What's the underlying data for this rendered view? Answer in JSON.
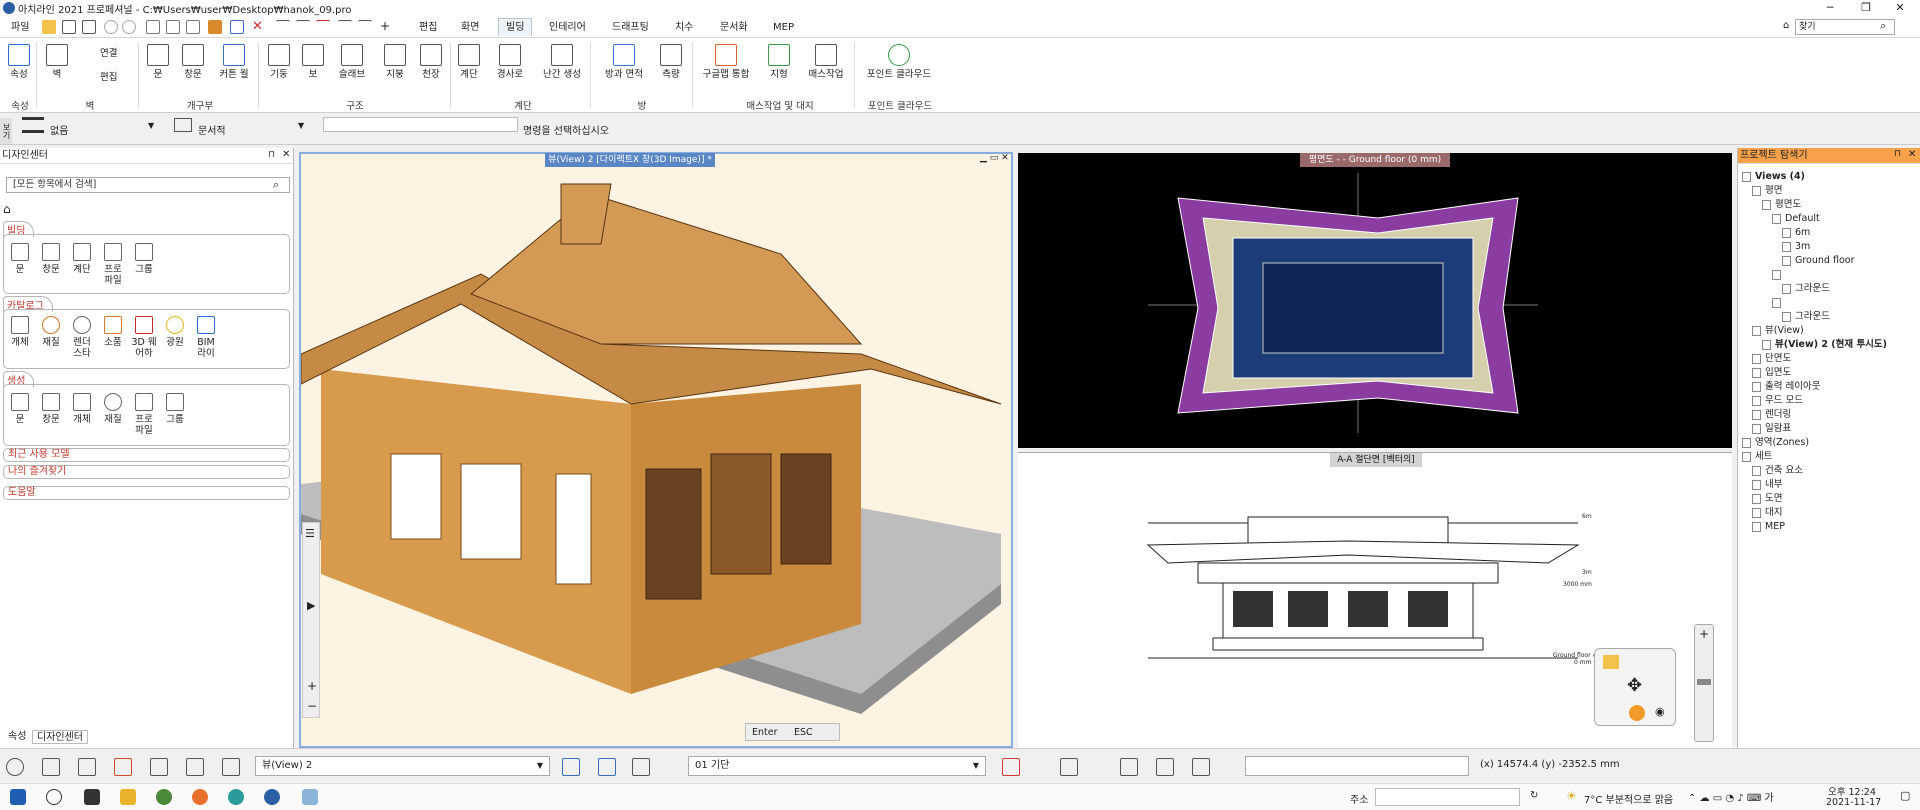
{
  "window": {
    "title": "아치라인 2021  프로페셔널 - C:₩Users₩user₩Desktop₩hanok_09.pro",
    "controls": [
      "─",
      "❐",
      "✕"
    ]
  },
  "menu_tabs": [
    "파일",
    "편집",
    "화면",
    "빌딩",
    "인테리어",
    "드래프팅",
    "치수",
    "문서화",
    "MEP"
  ],
  "search_placeholder": "찾기",
  "ribbon": {
    "buttons": [
      {
        "label": "속성"
      },
      {
        "label": "벽"
      },
      {
        "label": "연결"
      },
      {
        "label": "편집"
      },
      {
        "label": "문"
      },
      {
        "label": "창문"
      },
      {
        "label": "커튼 월"
      },
      {
        "label": "기둥"
      },
      {
        "label": "보"
      },
      {
        "label": "슬래브"
      },
      {
        "label": "지붕"
      },
      {
        "label": "천장"
      },
      {
        "label": "계단"
      },
      {
        "label": "경사로"
      },
      {
        "label": "난간 생성"
      },
      {
        "label": "방과 면적"
      },
      {
        "label": "측량"
      },
      {
        "label": "구글맵 통합"
      },
      {
        "label": "지형"
      },
      {
        "label": "매스작업"
      },
      {
        "label": "포인트 클라우드"
      }
    ],
    "groups": [
      "속성",
      "벽",
      "개구부",
      "구조",
      "계단",
      "방",
      "매스작업 및 대지",
      "포인트 클라우드"
    ]
  },
  "infobar": {
    "side_tab": "보기",
    "layer": "없음",
    "doc": "문서적",
    "prompt": "명령을 선택하십시오"
  },
  "design_center": {
    "title": "디자인센터",
    "search": "[모든 항목에서 검색]",
    "sections": [
      {
        "label": "빌딩",
        "items": [
          "문",
          "창문",
          "계단",
          "프로 파일",
          "그룹"
        ]
      },
      {
        "label": "카탈로그",
        "items": [
          "개체",
          "재질",
          "렌더 스타",
          "소품",
          "3D 웨어하",
          "광원",
          "BIM 라이"
        ]
      },
      {
        "label": "생성",
        "items": [
          "문",
          "창문",
          "개체",
          "재질",
          "프로 파일",
          "그룹"
        ]
      }
    ],
    "bars": [
      "최근 사용 모델",
      "나의 즐겨찾기",
      "도움말"
    ],
    "bottom_tabs": [
      "속성",
      "디자인센터"
    ]
  },
  "viewports": {
    "view3d_title": "뷰(View) 2 [다이렉트X 창(3D Image)] *",
    "plan_title": "평면도 -  - Ground floor (0 mm)",
    "section_title": "A-A 절단면 [벡터의]",
    "section_labels": [
      "6m",
      "3m",
      "3000 mm",
      "Ground floor #",
      "0 mm"
    ],
    "keys": [
      "Enter",
      "ESC"
    ]
  },
  "project_browser": {
    "title": "프로젝트 탐색기",
    "tree": [
      {
        "label": "Views (4)",
        "depth": 0,
        "bold": true
      },
      {
        "label": "평면",
        "depth": 1
      },
      {
        "label": "평면도",
        "depth": 2
      },
      {
        "label": "Default",
        "depth": 3
      },
      {
        "label": "6m",
        "depth": 4
      },
      {
        "label": "3m",
        "depth": 4
      },
      {
        "label": "Ground floor",
        "depth": 4
      },
      {
        "label": "",
        "depth": 3
      },
      {
        "label": "그라운드",
        "depth": 4
      },
      {
        "label": "",
        "depth": 3
      },
      {
        "label": "그라운드",
        "depth": 4
      },
      {
        "label": "뷰(View)",
        "depth": 1
      },
      {
        "label": "뷰(View) 2 (현재 투시도)",
        "depth": 2,
        "bold": true
      },
      {
        "label": "단면도",
        "depth": 1
      },
      {
        "label": "입면도",
        "depth": 1
      },
      {
        "label": "출력 레이아웃",
        "depth": 1
      },
      {
        "label": "우드 모드",
        "depth": 1
      },
      {
        "label": "렌더링",
        "depth": 1
      },
      {
        "label": "일람표",
        "depth": 1
      },
      {
        "label": "영역(Zones)",
        "depth": 0
      },
      {
        "label": "세트",
        "depth": 0
      },
      {
        "label": "건축 요소",
        "depth": 1
      },
      {
        "label": "내부",
        "depth": 1
      },
      {
        "label": "도면",
        "depth": 1
      },
      {
        "label": "대지",
        "depth": 1
      },
      {
        "label": "MEP",
        "depth": 1
      }
    ]
  },
  "statusbar": {
    "view_select": "뷰(View) 2",
    "storey_select": "01 기단",
    "coords": "(x) 14574.4   (y) -2352.5 mm"
  },
  "taskbar": {
    "address_label": "주소",
    "weather": "7°C 부분적으로 맑음",
    "time": "오후 12:24",
    "date": "2021-11-17"
  }
}
